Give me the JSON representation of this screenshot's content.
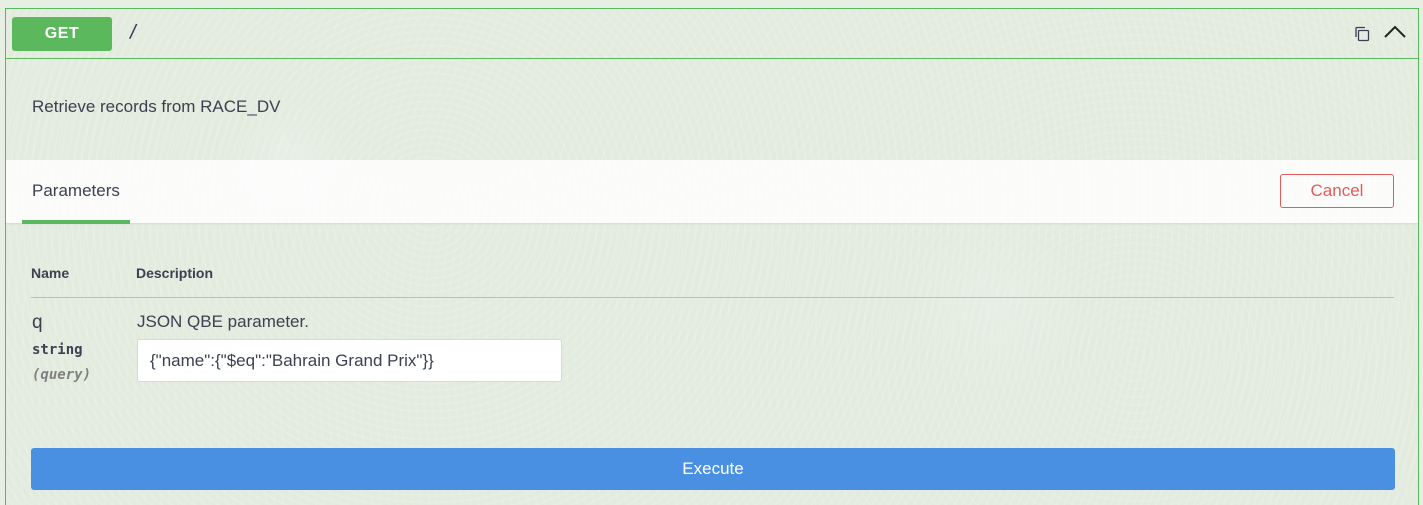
{
  "operation": {
    "method": "GET",
    "path": "/",
    "description": "Retrieve records from RACE_DV",
    "icons": {
      "copy": "copy-icon",
      "collapse": "chevron-up-icon"
    }
  },
  "parameters_section": {
    "tab_label": "Parameters",
    "cancel_label": "Cancel",
    "columns": {
      "name": "Name",
      "description": "Description"
    },
    "params": [
      {
        "name": "q",
        "type": "string",
        "in": "(query)",
        "description": "JSON QBE parameter.",
        "value": "{\"name\":{\"$eq\":\"Bahrain Grand Prix\"}}"
      }
    ]
  },
  "actions": {
    "execute_label": "Execute"
  },
  "colors": {
    "get_green": "#5cb85c",
    "execute_blue": "#4990e2",
    "cancel_red": "#e55a5a",
    "text": "#3b4151"
  }
}
